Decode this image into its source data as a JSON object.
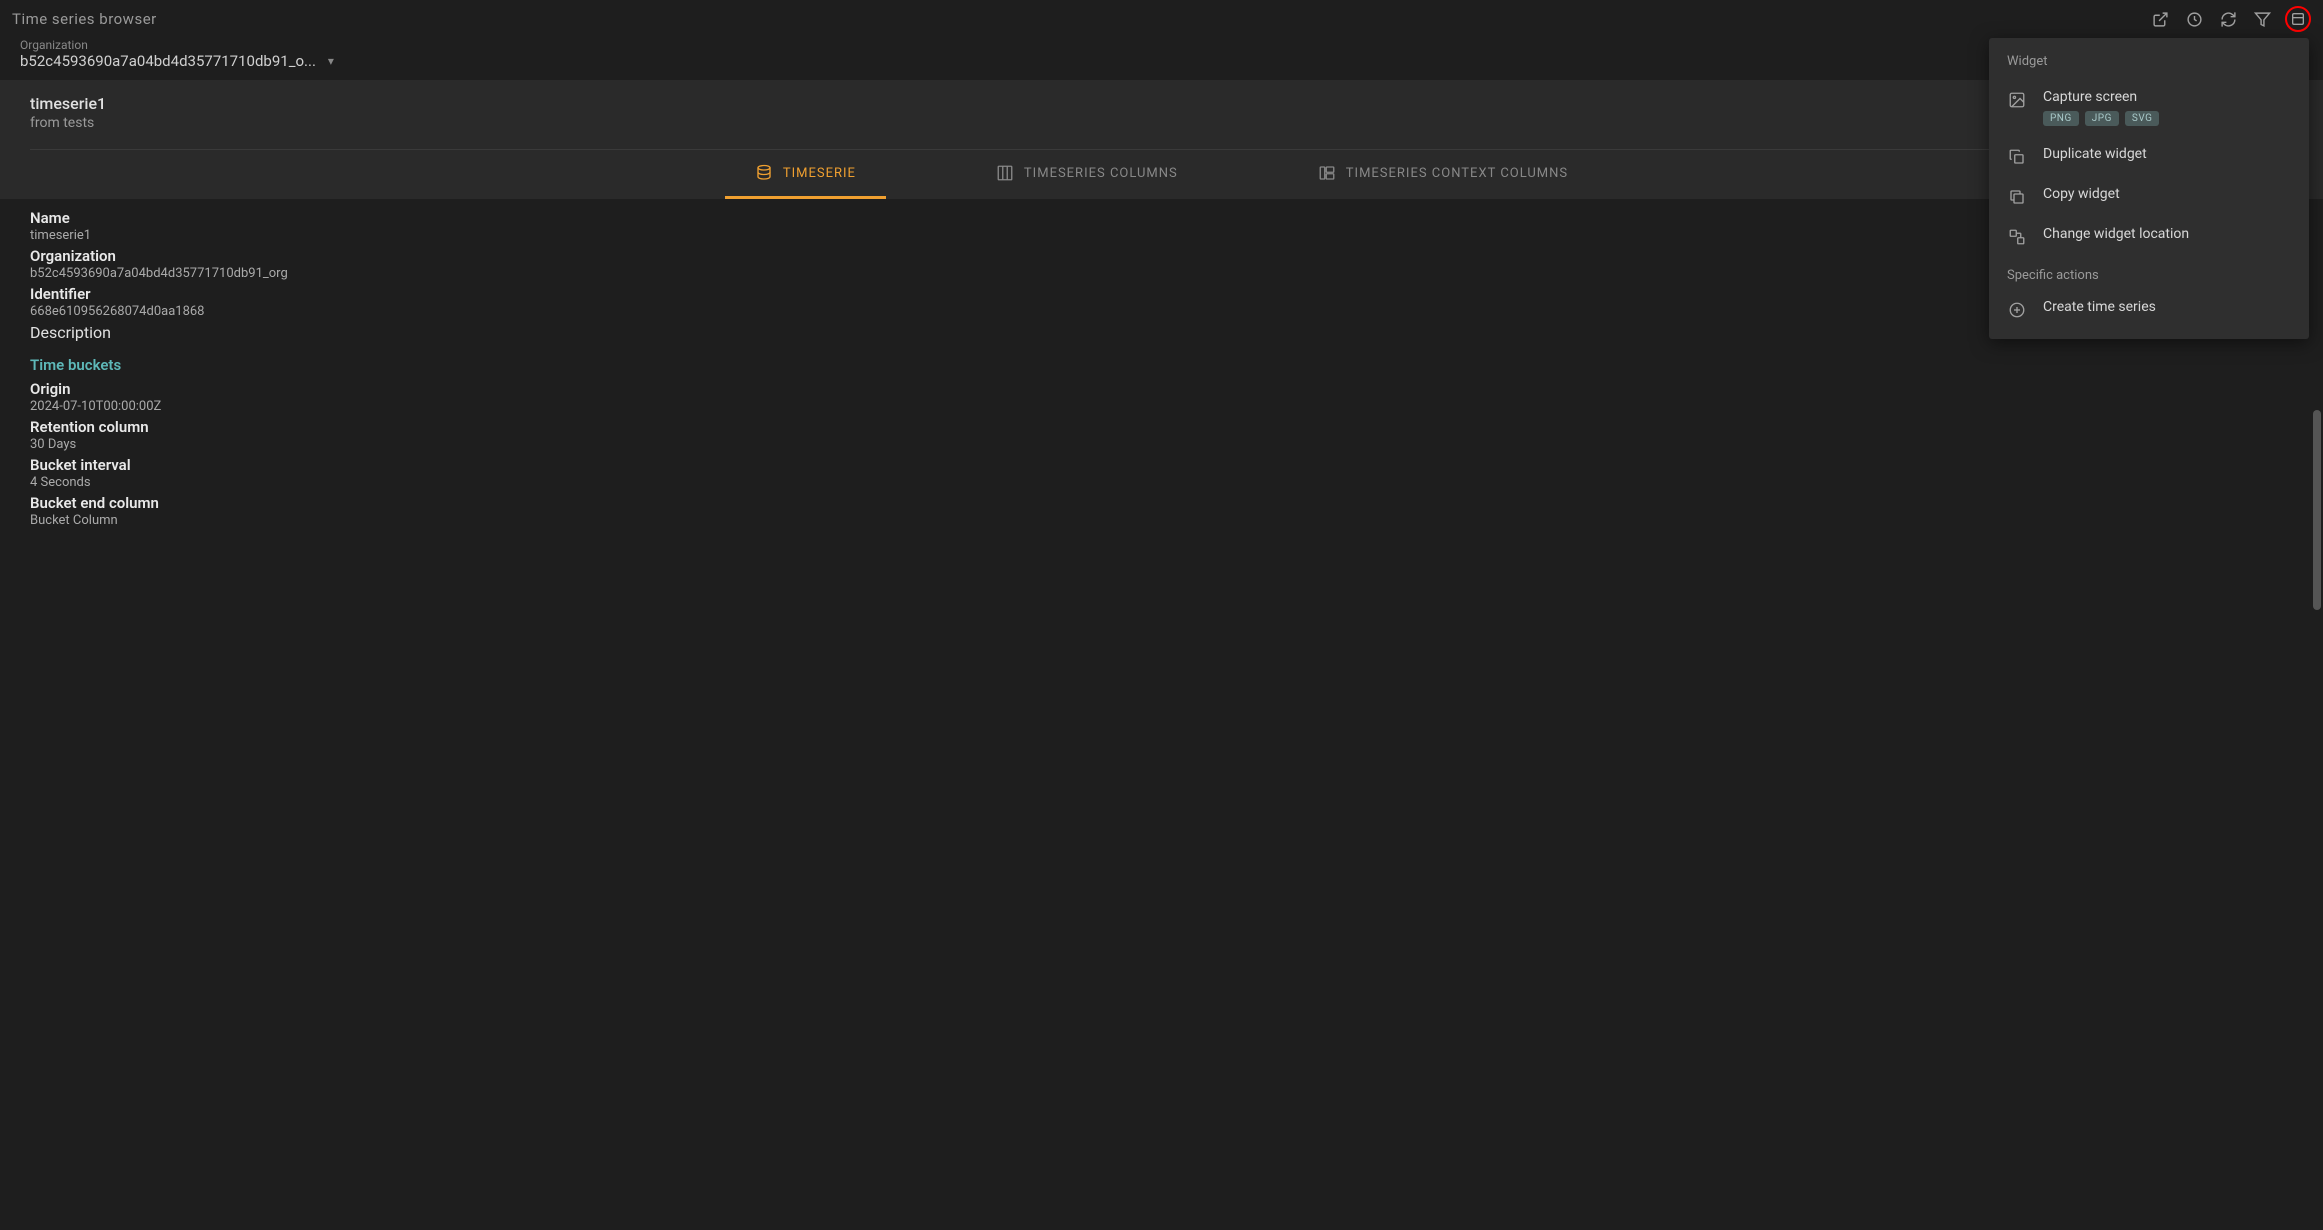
{
  "title": "Time series browser",
  "organization": {
    "label": "Organization",
    "value": "b52c4593690a7a04bd4d35771710db91_o..."
  },
  "header": {
    "title": "timeserie1",
    "subtitle": "from tests"
  },
  "tabs": [
    {
      "label": "TIMESERIE",
      "active": true
    },
    {
      "label": "TIMESERIES COLUMNS",
      "active": false
    },
    {
      "label": "TIMESERIES CONTEXT COLUMNS",
      "active": false
    }
  ],
  "details": {
    "name": {
      "label": "Name",
      "value": "timeserie1"
    },
    "organization": {
      "label": "Organization",
      "value": "b52c4593690a7a04bd4d35771710db91_org"
    },
    "identifier": {
      "label": "Identifier",
      "value": "668e610956268074d0aa1868"
    },
    "description_label": "Description"
  },
  "time_buckets": {
    "title": "Time buckets",
    "origin": {
      "label": "Origin",
      "value": "2024-07-10T00:00:00Z"
    },
    "retention": {
      "label": "Retention column",
      "value": "30 Days"
    },
    "interval": {
      "label": "Bucket interval",
      "value": "4 Seconds"
    },
    "end": {
      "label": "Bucket end column",
      "value": "Bucket Column"
    }
  },
  "popup": {
    "header": "Widget",
    "capture": {
      "label": "Capture screen",
      "badges": [
        "PNG",
        "JPG",
        "SVG"
      ]
    },
    "duplicate": "Duplicate widget",
    "copy": "Copy widget",
    "change_location": "Change widget location",
    "specific_header": "Specific actions",
    "create": "Create time series"
  }
}
